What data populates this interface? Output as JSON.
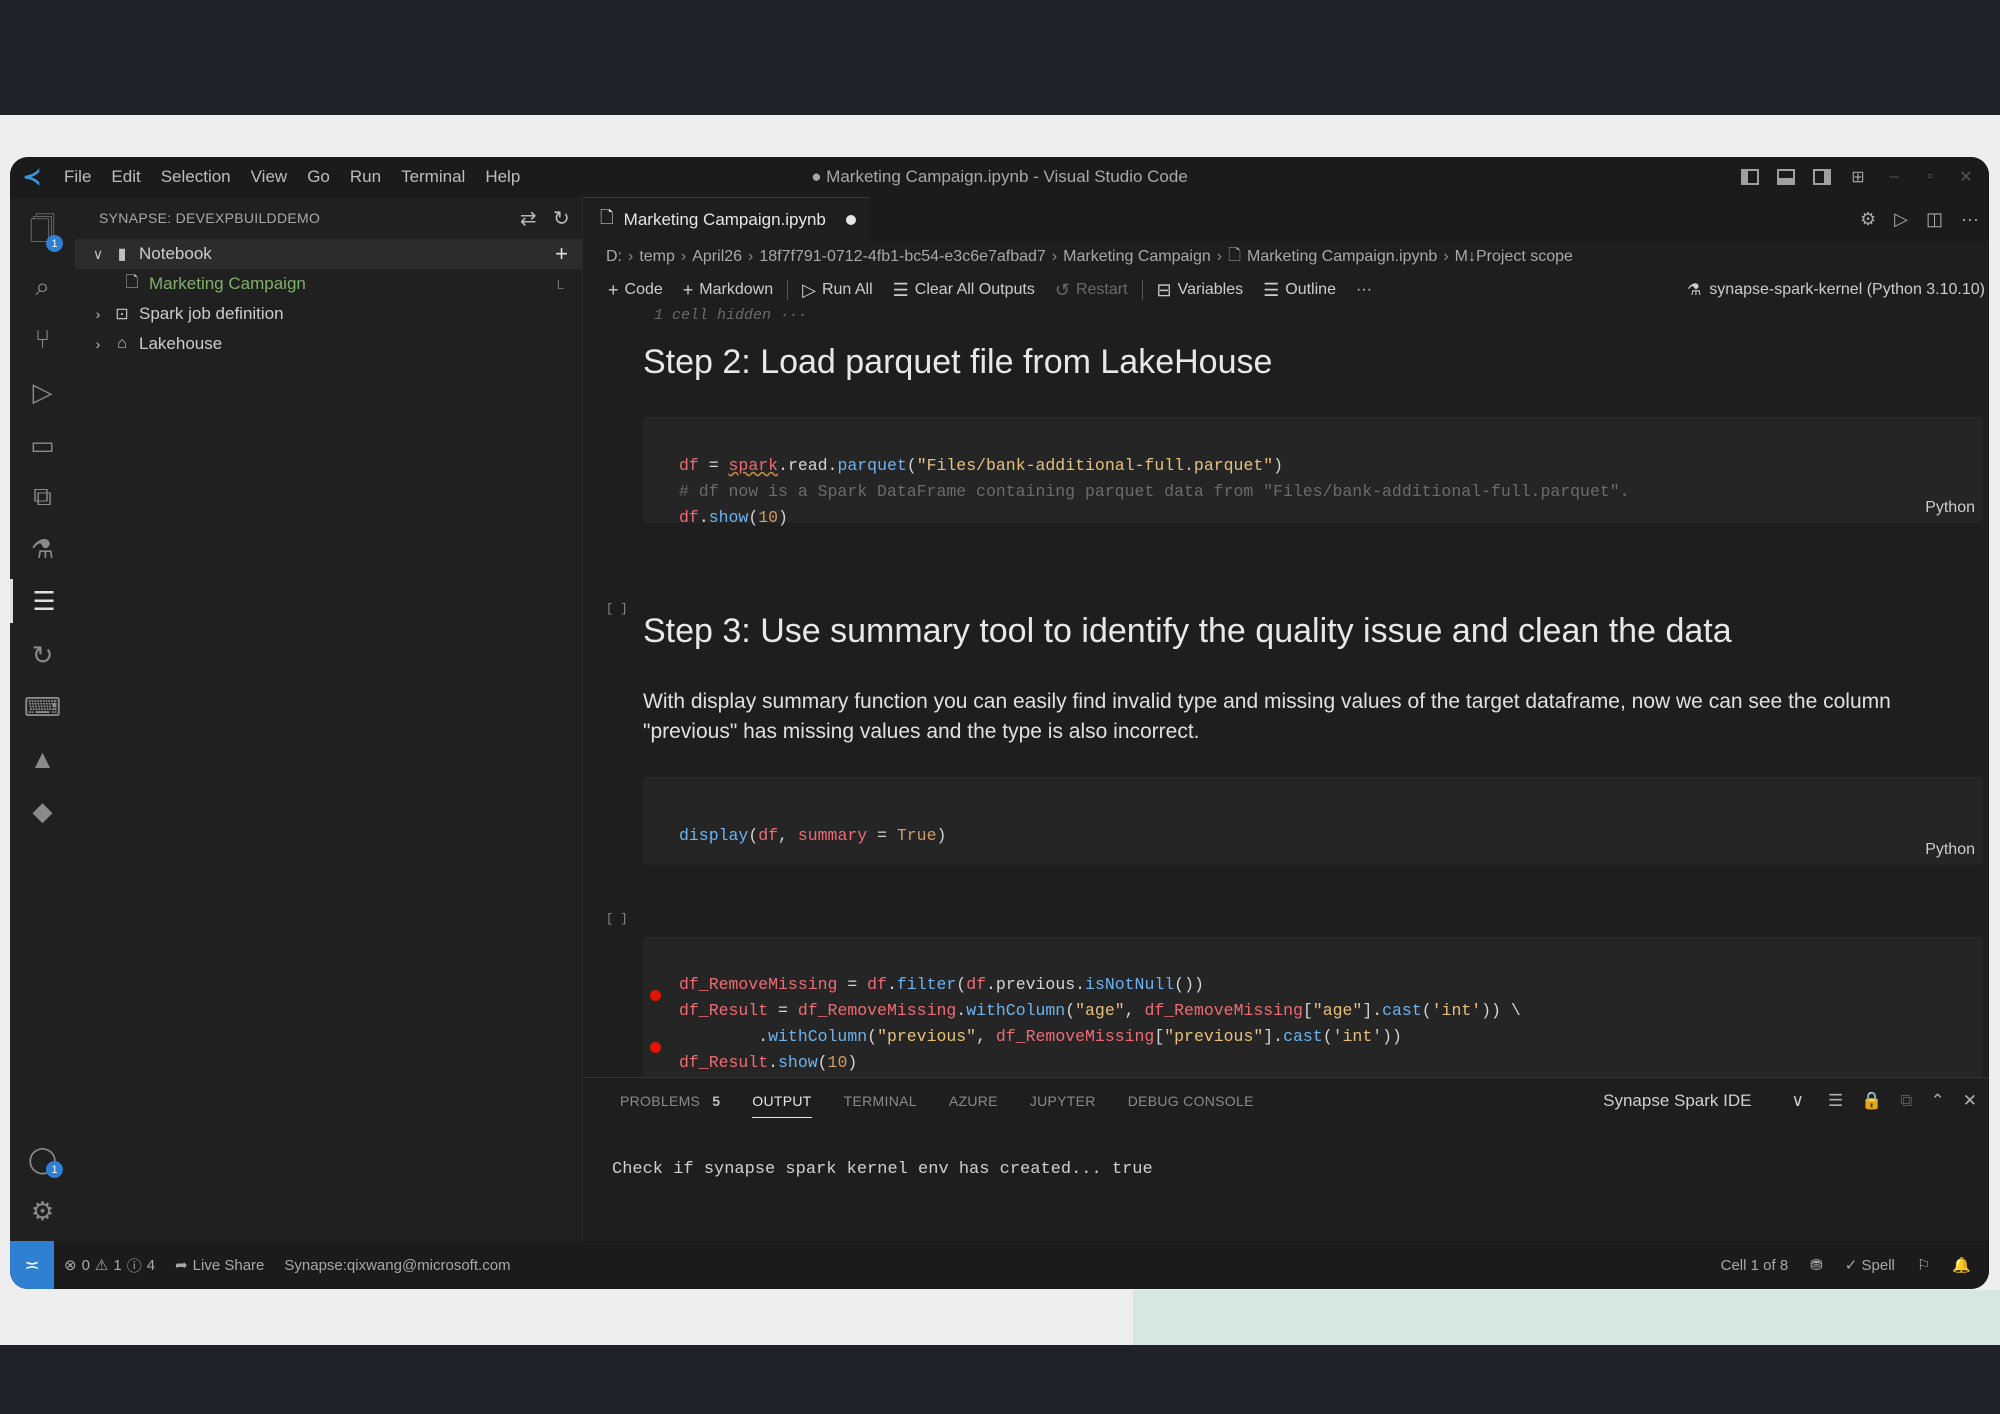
{
  "window": {
    "title": "● Marketing Campaign.ipynb - Visual Studio Code",
    "menu": [
      "File",
      "Edit",
      "Selection",
      "View",
      "Go",
      "Run",
      "Terminal",
      "Help"
    ]
  },
  "activity_bar": {
    "explorer_badge": "1",
    "accounts_badge": "1"
  },
  "sidebar": {
    "header": "SYNAPSE: DEVEXPBUILDDEMO",
    "tree": {
      "notebook": "Notebook",
      "marketing_campaign": "Marketing Campaign",
      "marketing_campaign_hint": "L",
      "spark_job": "Spark job definition",
      "lakehouse": "Lakehouse"
    }
  },
  "editor": {
    "tab": {
      "label": "Marketing Campaign.ipynb"
    },
    "breadcrumb": [
      "D:",
      "temp",
      "April26",
      "18f7f791-0712-4fb1-bc54-e3c6e7afbad7",
      "Marketing Campaign",
      "Marketing Campaign.ipynb",
      "M↓Project scope"
    ],
    "toolbar": {
      "code": "Code",
      "markdown": "Markdown",
      "run_all": "Run All",
      "clear_outputs": "Clear All Outputs",
      "restart": "Restart",
      "variables": "Variables",
      "outline": "Outline",
      "more": "···"
    },
    "kernel": "synapse-spark-kernel (Python 3.10.10)"
  },
  "notebook": {
    "hidden_cells": "1 cell hidden ···",
    "step2_heading": "Step 2: Load parquet file from LakeHouse",
    "step3_heading": "Step 3: Use summary tool to identify the quality issue and clean the data",
    "step3_paragraph": "With display summary function you can easily find invalid type and missing values of the target dataframe, now we can see the column \"previous\" has missing values and the type is also incorrect.",
    "cell_lang": "Python",
    "exec_count": "[ ]",
    "cell1": {
      "l1": {
        "a": "df",
        "b": " = ",
        "c": "spark",
        "d": ".read.",
        "e": "parquet",
        "f": "(",
        "g": "\"Files/bank-additional-full.parquet\"",
        "h": ")"
      },
      "l2": "# df now is a Spark DataFrame containing parquet data from \"Files/bank-additional-full.parquet\".",
      "l3": {
        "a": "df",
        "b": ".",
        "c": "show",
        "d": "(",
        "e": "10",
        "f": ")"
      }
    },
    "cell2": {
      "l1": {
        "a": "display",
        "b": "(",
        "c": "df",
        "d": ", ",
        "e": "summary",
        "f": " = ",
        "g": "True",
        "h": ")"
      }
    },
    "cell3": {
      "l1": {
        "a": "df_RemoveMissing",
        "b": " = ",
        "c": "df",
        "d": ".",
        "e": "filter",
        "f": "(",
        "g": "df",
        "h": ".previous.",
        "i": "isNotNull",
        "j": "())"
      },
      "l2": {
        "a": "df_Result",
        "b": " = ",
        "c": "df_RemoveMissing",
        "d": ".",
        "e": "withColumn",
        "f": "(",
        "g": "\"age\"",
        "h": ", ",
        "i": "df_RemoveMissing",
        "j": "[",
        "k": "\"age\"",
        "l": "].",
        "m": "cast",
        "n": "(",
        "o": "'int'",
        "p": ")) \\"
      },
      "l3": {
        "a": "        .",
        "b": "withColumn",
        "c": "(",
        "d": "\"previous\"",
        "e": ", ",
        "f": "df_RemoveMissing",
        "g": "[",
        "h": "\"previous\"",
        "i": "].",
        "j": "cast",
        "k": "(",
        "l": "'int'",
        "m": "))"
      },
      "l4": {
        "a": "df_Result",
        "b": ".",
        "c": "show",
        "d": "(",
        "e": "10",
        "f": ")"
      }
    }
  },
  "panel": {
    "tabs": [
      "PROBLEMS",
      "OUTPUT",
      "TERMINAL",
      "AZURE",
      "JUPYTER",
      "DEBUG CONSOLE"
    ],
    "problems_count": "5",
    "output_channel": "Synapse Spark IDE",
    "output_line": "Check if synapse spark kernel env has created... true"
  },
  "statusbar": {
    "errors": "0",
    "warnings": "1",
    "info": "4",
    "live_share": "Live Share",
    "account": "Synapse:qixwang@microsoft.com",
    "cell_position": "Cell 1 of 8",
    "spell": "Spell"
  }
}
